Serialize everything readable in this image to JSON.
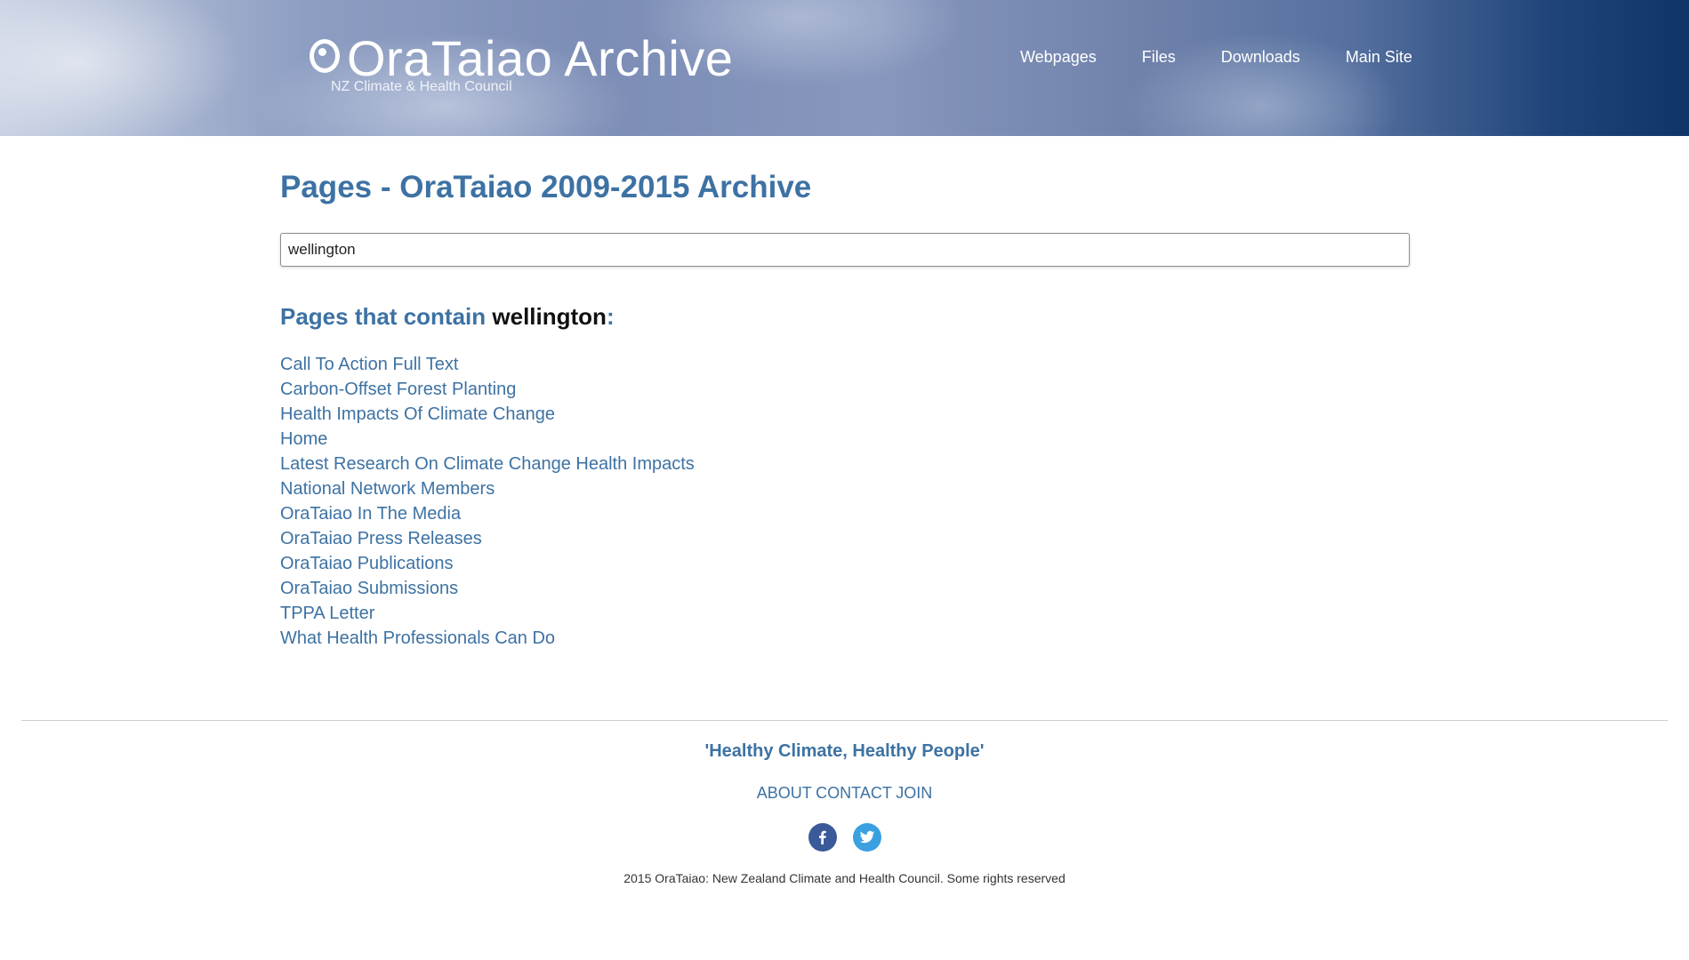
{
  "header": {
    "logo_title": "OraTaiao Archive",
    "logo_subtitle": "NZ Climate & Health Council",
    "nav": [
      {
        "label": "Webpages"
      },
      {
        "label": "Files"
      },
      {
        "label": "Downloads"
      },
      {
        "label": "Main Site"
      }
    ]
  },
  "main": {
    "title": "Pages - OraTaiao 2009-2015 Archive",
    "search": {
      "value": "wellington"
    },
    "results_heading_prefix": "Pages that contain ",
    "results_heading_term": "wellington",
    "results_heading_suffix": ":",
    "results": [
      {
        "label": "Call To Action Full Text"
      },
      {
        "label": "Carbon-Offset Forest Planting"
      },
      {
        "label": "Health Impacts Of Climate Change"
      },
      {
        "label": "Home"
      },
      {
        "label": "Latest Research On Climate Change Health Impacts"
      },
      {
        "label": "National Network Members"
      },
      {
        "label": "OraTaiao In The Media"
      },
      {
        "label": "OraTaiao Press Releases"
      },
      {
        "label": "OraTaiao Publications"
      },
      {
        "label": "OraTaiao Submissions"
      },
      {
        "label": "TPPA Letter"
      },
      {
        "label": "What Health Professionals Can Do"
      }
    ]
  },
  "footer": {
    "tagline": "'Healthy Climate, Healthy People'",
    "links": [
      {
        "label": "ABOUT"
      },
      {
        "label": "CONTACT"
      },
      {
        "label": "JOIN"
      }
    ],
    "social": [
      {
        "icon": "facebook-icon",
        "color": "#3b5a99"
      },
      {
        "icon": "twitter-icon",
        "color": "#3aa0e0"
      }
    ],
    "copyright": "2015 OraTaiao: New Zealand Climate and Health Council. Some rights reserved"
  },
  "colors": {
    "accent": "#3d72a3",
    "header_dark": "#0f3568"
  }
}
